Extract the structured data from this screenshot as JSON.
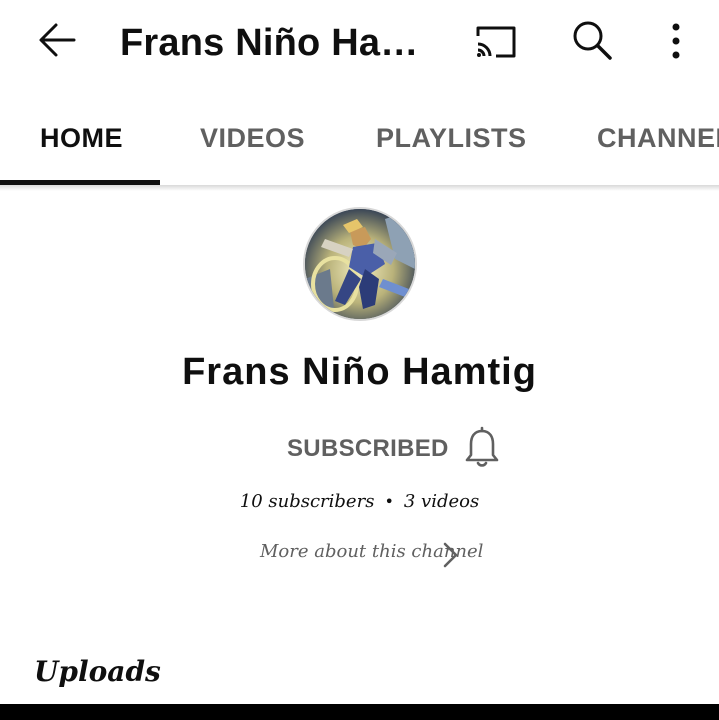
{
  "header": {
    "title": "Frans Niño Ham...",
    "icons": [
      "back-arrow-icon",
      "cast-icon",
      "search-icon",
      "more-vert-icon"
    ]
  },
  "tabs": [
    {
      "label": "HOME",
      "active": true
    },
    {
      "label": "VIDEOS",
      "active": false
    },
    {
      "label": "PLAYLISTS",
      "active": false
    },
    {
      "label": "CHANNEL",
      "active": false
    }
  ],
  "channel": {
    "name": "Frans Niño Hamtig",
    "subscribe_label": "SUBSCRIBED",
    "subscribers": "10 subscribers",
    "separator": "•",
    "videos": "3 videos",
    "about_label": "More about this channel"
  },
  "sections": {
    "uploads_title": "Uploads"
  },
  "colors": {
    "primary_text": "#0f0f0f",
    "secondary_text": "#606060",
    "background": "#ffffff"
  }
}
